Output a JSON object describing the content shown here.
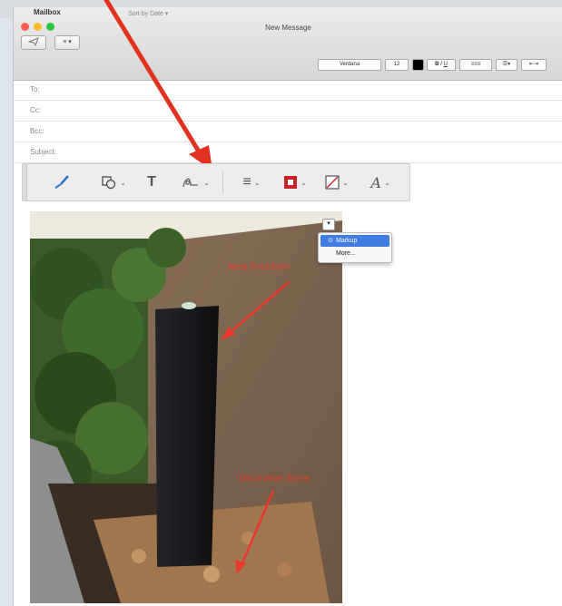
{
  "window": {
    "title": "New Message",
    "mailbox_tab": "Mailbox",
    "sort_tab": "Sort by Date ▾"
  },
  "toolbar": {
    "send_icon": "paper-plane-icon",
    "attach_label": "≡ ▾"
  },
  "format_bar": {
    "font": "Verdana",
    "size": "12",
    "color": "#000000"
  },
  "fields": {
    "to_label": "To:",
    "cc_label": "Cc:",
    "bcc_label": "Bcc:",
    "subject_label": "Subject:"
  },
  "markup_toolbar": {
    "tools": [
      "sketch-pen-icon",
      "shapes-icon",
      "text-icon",
      "signature-icon",
      "line-style-icon",
      "border-color-icon",
      "fill-color-icon",
      "text-style-icon"
    ]
  },
  "photo": {
    "annotations": {
      "fountain": "New Fountain",
      "stone": "Decorative Stone"
    }
  },
  "extension_menu": {
    "button_icon": "chevron-down-icon",
    "items": [
      {
        "label": "Markup",
        "icon": "markup-icon",
        "selected": true
      },
      {
        "label": "More...",
        "icon": "",
        "selected": false
      }
    ]
  },
  "colors": {
    "accent": "#3f7be0",
    "annotation": "#e8372b"
  }
}
